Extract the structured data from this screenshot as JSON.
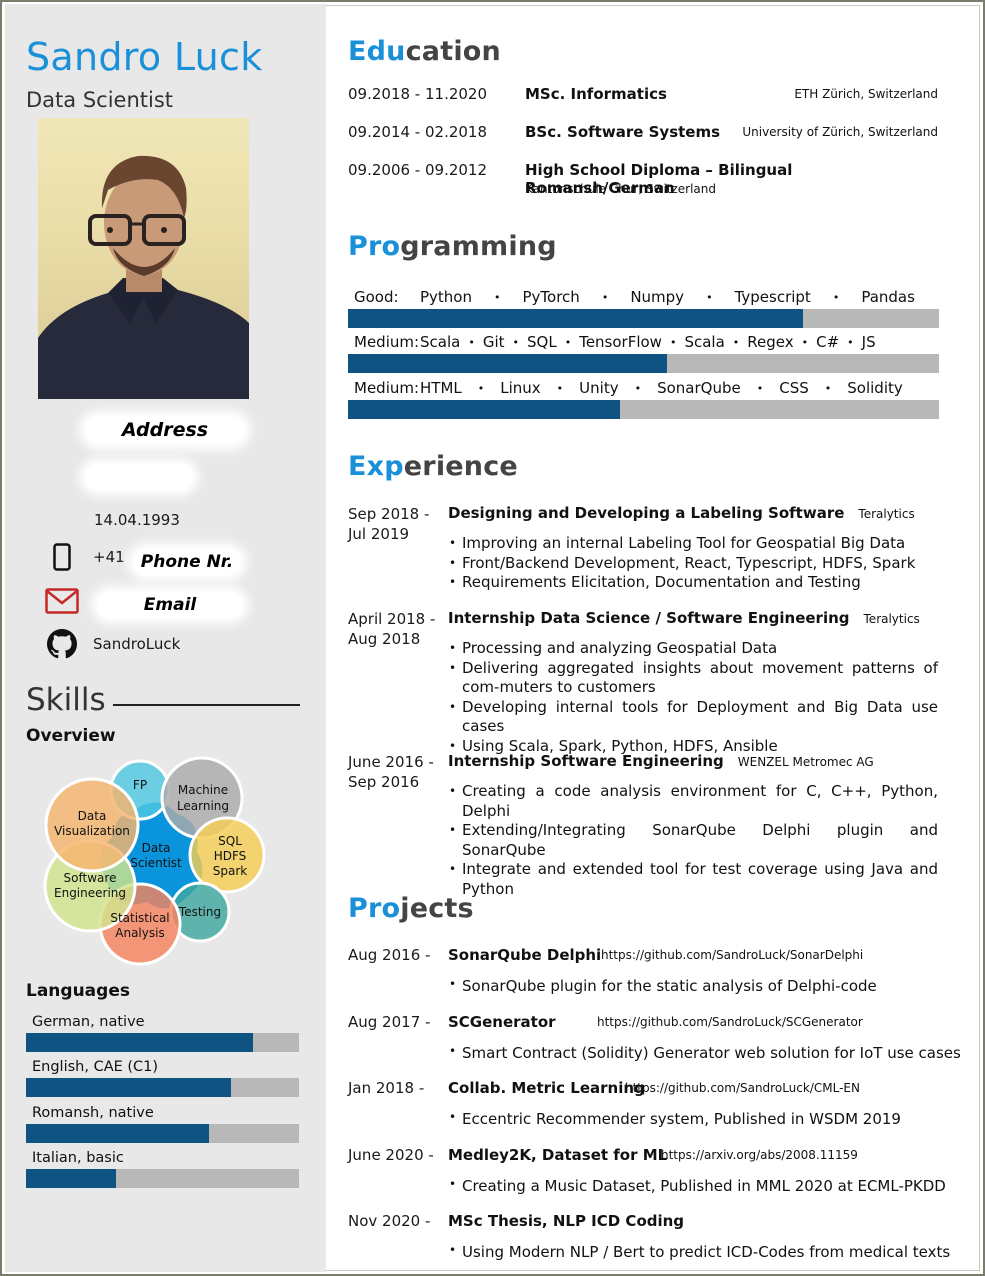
{
  "profile": {
    "name": "Sandro Luck",
    "role": "Data Scientist",
    "photo_alt": "Portrait photo",
    "address_label": "Address",
    "birthdate": "14.04.1993",
    "phone_prefix": "+41",
    "phone_label": "Phone Nr.",
    "email_label": "Email",
    "github": "SandroLuck"
  },
  "icons": {
    "phone": "phone-icon",
    "email": "envelope-icon",
    "github": "github-icon"
  },
  "colors": {
    "accent": "#1a90d9",
    "bar_fill": "#0e5382",
    "bar_track": "#b8b8b8",
    "sidebar_bg": "#e8e8e8",
    "email_icon": "#c62828"
  },
  "skills": {
    "title": "Skills",
    "overview_label": "Overview",
    "center": "Data Scientist",
    "bubbles": [
      {
        "label": "FP",
        "color": "#4fc8e0"
      },
      {
        "label": "Machine Learning",
        "color": "#ababab"
      },
      {
        "label": "SQL HDFS Spark",
        "color": "#f5cd55"
      },
      {
        "label": "Testing",
        "color": "#3fa8a0"
      },
      {
        "label": "Statistical Analysis",
        "color": "#f5845e"
      },
      {
        "label": "Software Engineering",
        "color": "#d2e48c"
      },
      {
        "label": "Data Visualization",
        "color": "#f5b56e"
      }
    ]
  },
  "languages": {
    "title": "Languages",
    "items": [
      {
        "label": "German, native",
        "level": 0.83
      },
      {
        "label": "English, CAE (C1)",
        "level": 0.75
      },
      {
        "label": "Romansh, native",
        "level": 0.67
      },
      {
        "label": "Italian, basic",
        "level": 0.33
      }
    ]
  },
  "education": {
    "title_hl": "Edu",
    "title_rest": "cation",
    "items": [
      {
        "dates": "09.2018 - 11.2020",
        "degree": "MSc. Informatics",
        "institution": "ETH Zürich, Switzerland",
        "sub": ""
      },
      {
        "dates": "09.2014 - 02.2018",
        "degree": "BSc. Software Systems",
        "institution": "University of Zürich, Switzerland",
        "sub": ""
      },
      {
        "dates": "09.2006 - 09.2012",
        "degree": "High School Diploma – Bilingual Romansh/German",
        "institution": "",
        "sub": "Kantonschule Chur, Switzerland"
      }
    ]
  },
  "programming": {
    "title_hl": "Pro",
    "title_rest": "gramming",
    "rows": [
      {
        "level_label": "Good:",
        "skills": [
          "Python",
          "PyTorch",
          "Numpy",
          "Typescript",
          "Pandas"
        ],
        "level": 0.77
      },
      {
        "level_label": "Medium:",
        "skills": [
          "Scala",
          "Git",
          "SQL",
          "TensorFlow",
          "Scala",
          "Regex",
          "C#",
          "JS"
        ],
        "level": 0.54
      },
      {
        "level_label": "Medium:",
        "skills": [
          "HTML",
          "Linux",
          "Unity",
          "SonarQube",
          "CSS",
          "Solidity"
        ],
        "level": 0.46
      }
    ],
    "separator": "•"
  },
  "experience": {
    "title_hl": "Exp",
    "title_rest": "erience",
    "items": [
      {
        "date_start": "Sep 2018 -",
        "date_end": "Jul 2019",
        "title": "Designing and Developing a Labeling Software",
        "company": "Teralytics",
        "bullets": [
          "Improving an internal Labeling Tool for Geospatial Big Data",
          "Front/Backend Development, React, Typescript, HDFS, Spark",
          "Requirements Elicitation, Documentation and Testing"
        ]
      },
      {
        "date_start": "April 2018 -",
        "date_end": "Aug 2018",
        "title": "Internship Data Science / Software Engineering",
        "company": "Teralytics",
        "bullets": [
          "Processing and analyzing Geospatial Data",
          "Delivering aggregated insights about movement patterns of com-muters to customers",
          "Developing internal tools for Deployment and Big Data use cases",
          "Using Scala, Spark, Python, HDFS, Ansible"
        ]
      },
      {
        "date_start": "June 2016 -",
        "date_end": "Sep 2016",
        "title": "Internship Software Engineering",
        "company": "WENZEL Metromec AG",
        "bullets": [
          "Creating a code analysis environment for C, C++, Python, Delphi",
          "Extending/Integrating SonarQube Delphi plugin and SonarQube",
          "Integrate and extended tool for test coverage using Java and Python"
        ]
      }
    ]
  },
  "projects": {
    "title_hl": "Pro",
    "title_rest": "jects",
    "items": [
      {
        "date": "Aug 2016 -",
        "title": "SonarQube Delphi",
        "url": "https://github.com/SandroLuck/SonarDelphi",
        "bullet": "SonarQube plugin for the static analysis of Delphi-code"
      },
      {
        "date": "Aug 2017 -",
        "title": "SCGenerator",
        "url": "https://github.com/SandroLuck/SCGenerator",
        "bullet": "Smart Contract (Solidity) Generator web solution for IoT use cases"
      },
      {
        "date": "Jan 2018 -",
        "title": "Collab. Metric Learning",
        "url": "https://github.com/SandroLuck/CML-EN",
        "bullet": "Eccentric Recommender system, Published in WSDM 2019"
      },
      {
        "date": "June 2020 -",
        "title": "Medley2K, Dataset for ML",
        "url": "https://arxiv.org/abs/2008.11159",
        "bullet": "Creating a Music Dataset, Published in MML 2020 at ECML-PKDD"
      },
      {
        "date": "Nov 2020 -",
        "title": "MSc Thesis, NLP ICD Coding",
        "url": "",
        "bullet": "Using Modern NLP / Bert to predict ICD-Codes from medical texts"
      }
    ]
  }
}
